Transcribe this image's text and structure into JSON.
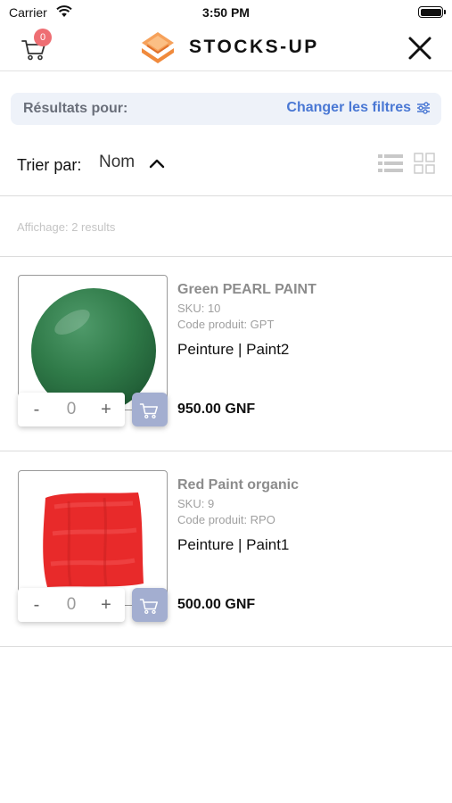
{
  "status_bar": {
    "carrier": "Carrier",
    "time": "3:50 PM"
  },
  "header": {
    "brand": "STOCKS-UP",
    "cart_count": "0"
  },
  "filters": {
    "results_label": "Résultats pour:",
    "change_label": "Changer les filtres"
  },
  "sort": {
    "label": "Trier par:",
    "value": "Nom"
  },
  "display_count": "Affichage: 2 results",
  "colors": {
    "accent": "#4a78d4",
    "badge": "#ee6e73",
    "brand_orange": "#f08a3c",
    "cart_button": "#a3aed0"
  },
  "products": [
    {
      "name": "Green PEARL PAINT",
      "sku": "SKU: 10",
      "code": "Code produit: GPT",
      "category": "Peinture | Paint2",
      "price": "950.00 GNF",
      "quantity": "0",
      "qty_minus": "-",
      "qty_plus": "+",
      "image": "green-paint-ball"
    },
    {
      "name": "Red Paint organic",
      "sku": "SKU: 9",
      "code": "Code produit: RPO",
      "category": "Peinture | Paint1",
      "price": "500.00 GNF",
      "quantity": "0",
      "qty_minus": "-",
      "qty_plus": "+",
      "image": "red-paint-swatch"
    }
  ]
}
